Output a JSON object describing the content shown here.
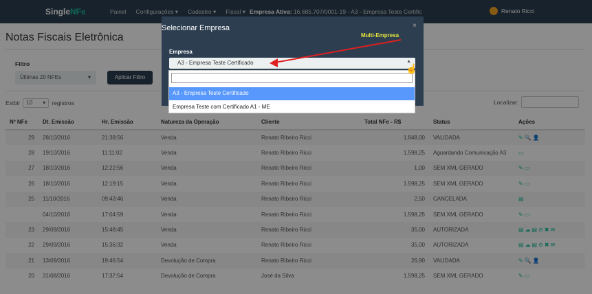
{
  "navbar": {
    "brand_a": "Single",
    "brand_b": "NFe",
    "items": [
      "Painel",
      "Configurações ▾",
      "Cadastro ▾",
      "Fiscal ▾"
    ],
    "active_company_label": "Empresa Ativa:",
    "active_company_value": "16.685.707/0001-19 - A3 - Empresa Teste Certific",
    "user_name": "Renato Ricci"
  },
  "page": {
    "title": "Notas Fiscais Eletrônica",
    "filter_label": "Filtro",
    "filter_value": "Últimas 20 NFEs",
    "apply_filter_label": "Aplicar Filtro",
    "show_label": "Exibir",
    "show_value": "10",
    "records_label": "registros",
    "search_label": "Localizar:"
  },
  "table": {
    "headers": [
      "Nº NFe",
      "Dt. Emissão",
      "Hr. Emissão",
      "Natureza da Operação",
      "Cliente",
      "Total NFe - R$",
      "Status",
      "Ações"
    ],
    "rows": [
      {
        "n": "29",
        "date": "28/10/2016",
        "time": "21:38:56",
        "nature": "Venda",
        "client": "Renato Ribeiro Ricci",
        "total": "1.848,00",
        "status": "VALIDADA",
        "actions": "✎🔍👤"
      },
      {
        "n": "28",
        "date": "19/10/2016",
        "time": "11:11:02",
        "nature": "Venda",
        "client": "Renato Ribeiro Ricci",
        "total": "1.598,25",
        "status": "Aguardando Comunicação A3",
        "actions": "▭"
      },
      {
        "n": "27",
        "date": "18/10/2016",
        "time": "12:22:56",
        "nature": "Venda",
        "client": "Renato Ribeiro Ricci",
        "total": "1,00",
        "status": "SEM XML GERADO",
        "actions": "✎▭"
      },
      {
        "n": "26",
        "date": "18/10/2016",
        "time": "12:19:15",
        "nature": "Venda",
        "client": "Renato Ribeiro Ricci",
        "total": "1.598,25",
        "status": "SEM XML GERADO",
        "actions": "✎▭"
      },
      {
        "n": "25",
        "date": "11/10/2016",
        "time": "09:43:46",
        "nature": "Venda",
        "client": "Renato Ribeiro Ricci",
        "total": "2,50",
        "status": "CANCELADA",
        "actions": "▤"
      },
      {
        "n": "",
        "date": "04/10/2016",
        "time": "17:04:59",
        "nature": "Venda",
        "client": "Renato Ribeiro Ricci",
        "total": "1.598,25",
        "status": "SEM XML GERADO",
        "actions": "✎▭"
      },
      {
        "n": "23",
        "date": "29/09/2016",
        "time": "15:48:45",
        "nature": "Venda",
        "client": "Renato Ribeiro Ricci",
        "total": "35,00",
        "status": "AUTORIZADA",
        "actions": "▤☁▤⊝✖✉"
      },
      {
        "n": "22",
        "date": "29/09/2016",
        "time": "15:36:32",
        "nature": "Venda",
        "client": "Renato Ribeiro Ricci",
        "total": "35,00",
        "status": "AUTORIZADA",
        "actions": "▤☁▤⊝✖✉"
      },
      {
        "n": "21",
        "date": "13/09/2016",
        "time": "19:46:54",
        "nature": "Devolução de Compra",
        "client": "Renato Ribeiro Ricci",
        "total": "26,90",
        "status": "VALIDADA",
        "actions": "✎🔍👤"
      },
      {
        "n": "20",
        "date": "31/08/2016",
        "time": "17:37:54",
        "nature": "Devolução de Compra",
        "client": "José da Silva",
        "total": "1.598,25",
        "status": "SEM XML GERADO",
        "actions": "✎▭"
      }
    ]
  },
  "modal": {
    "title": "Selecionar Empresa",
    "close": "×",
    "field_label": "Empresa",
    "selected_value": "A3 - Empresa Teste Certificado",
    "options": [
      "A3 - Empresa Teste Certificado",
      "Empresa Teste com Certificado A1 - ME"
    ]
  },
  "annotation": {
    "label": "Multi-Empresa",
    "color": "#e8e83a",
    "arrow_color": "#e02020"
  }
}
